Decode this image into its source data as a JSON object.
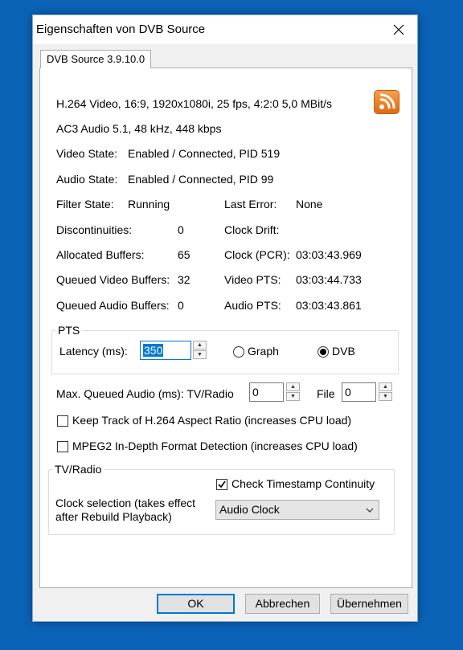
{
  "window": {
    "title": "Eigenschaften von DVB Source"
  },
  "tab": {
    "label": "DVB Source 3.9.10.0"
  },
  "info": {
    "video_line": "H.264 Video, 16:9, 1920x1080i, 25 fps, 4:2:0   5,0 MBit/s",
    "audio_line": "AC3 Audio 5.1, 48 kHz, 448 kbps",
    "video_state_label": "Video State:",
    "video_state_value": "Enabled / Connected, PID 519",
    "audio_state_label": "Audio State:",
    "audio_state_value": "Enabled / Connected, PID 99",
    "filter_state_label": "Filter State:",
    "filter_state_value": "Running",
    "last_error_label": "Last Error:",
    "last_error_value": "None",
    "discontinuities_label": "Discontinuities:",
    "discontinuities_value": "0",
    "clock_drift_label": "Clock Drift:",
    "clock_drift_value": "",
    "allocated_buffers_label": "Allocated Buffers:",
    "allocated_buffers_value": "65",
    "clock_pcr_label": "Clock (PCR):",
    "clock_pcr_value": "03:03:43.969",
    "queued_video_label": "Queued Video Buffers:",
    "queued_video_value": "32",
    "video_pts_label": "Video PTS:",
    "video_pts_value": "03:03:44.733",
    "queued_audio_label": "Queued Audio Buffers:",
    "queued_audio_value": "0",
    "audio_pts_label": "Audio PTS:",
    "audio_pts_value": "03:03:43.861"
  },
  "pts": {
    "group_label": "PTS",
    "latency_label": "Latency (ms):",
    "latency_value": "350",
    "graph_label": "Graph",
    "dvb_label": "DVB",
    "selected": "DVB"
  },
  "queue": {
    "label": "Max. Queued Audio (ms): TV/Radio",
    "tvradio_value": "0",
    "file_label": "File",
    "file_value": "0"
  },
  "options": {
    "aspect_label": "Keep Track of H.264 Aspect Ratio (increases CPU load)",
    "aspect_checked": false,
    "mpeg2_label": "MPEG2 In-Depth Format Detection (increases CPU load)",
    "mpeg2_checked": false
  },
  "tvradio": {
    "group_label": "TV/Radio",
    "timestamp_label": "Check Timestamp Continuity",
    "timestamp_checked": true,
    "clock_label_line1": "Clock selection (takes effect",
    "clock_label_line2": "after Rebuild Playback)",
    "clock_value": "Audio Clock"
  },
  "buttons": {
    "ok": "OK",
    "cancel": "Abbrechen",
    "apply": "Übernehmen"
  },
  "colors": {
    "accent": "#0078d7",
    "desktop": "#0b63b8",
    "rss_orange": "#f08a24"
  }
}
